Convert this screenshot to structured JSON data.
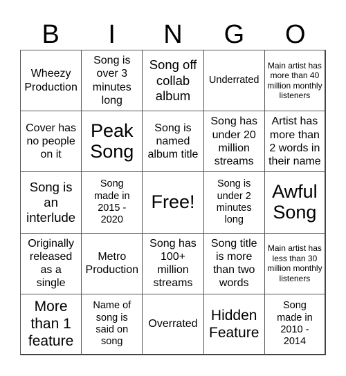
{
  "header": {
    "letters": [
      "B",
      "I",
      "N",
      "G",
      "O"
    ]
  },
  "cells": [
    {
      "text": "Wheezy Production"
    },
    {
      "text": "Song is over 3 minutes long"
    },
    {
      "text": "Song off collab album"
    },
    {
      "text": "Underrated"
    },
    {
      "text": "Main artist has more than 40 million monthly listeners"
    },
    {
      "text": "Cover has no people on it"
    },
    {
      "text": "Peak Song"
    },
    {
      "text": "Song is named album title"
    },
    {
      "text": "Song has under 20 million streams"
    },
    {
      "text": "Artist has more than 2 words in their name"
    },
    {
      "text": "Song is an interlude"
    },
    {
      "text": "Song made in 2015 - 2020"
    },
    {
      "text": "Free!"
    },
    {
      "text": "Song is under 2 minutes long"
    },
    {
      "text": "Awful Song"
    },
    {
      "text": "Originally released as a single"
    },
    {
      "text": "Metro Production"
    },
    {
      "text": "Song has 100+ million streams"
    },
    {
      "text": "Song title is more than two words"
    },
    {
      "text": "Main artist has less than 30 million monthly listeners"
    },
    {
      "text": "More than 1 feature"
    },
    {
      "text": "Name of song is said on song"
    },
    {
      "text": "Overrated"
    },
    {
      "text": "Hidden Feature"
    },
    {
      "text": "Song made in 2010 - 2014"
    }
  ]
}
